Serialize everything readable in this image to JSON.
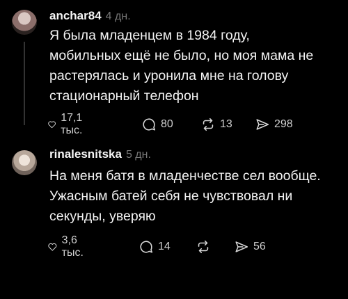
{
  "posts": [
    {
      "username": "anchar84",
      "time": "4 дн.",
      "text": "Я была младенцем в 1984 году,\nмобильных ещё не было, но моя мама не\nрастерялась и уронила мне на голову\nстационарный телефон",
      "likes": "17,1 тыс.",
      "comments": "80",
      "reposts": "13",
      "shares": "298"
    },
    {
      "username": "rinalesnitska",
      "time": "5 дн.",
      "text": "На меня батя в младенчестве сел вообще.\nУжасным батей себя не чувствовал ни\nсекунды, уверяю",
      "likes": "3,6 тыс.",
      "comments": "14",
      "reposts": "",
      "shares": "56"
    }
  ],
  "icons": [
    "heart-icon",
    "comment-icon",
    "repost-icon",
    "share-icon"
  ],
  "colors": {
    "background": "#000000",
    "text": "#f3f3f3",
    "muted": "#777777"
  }
}
